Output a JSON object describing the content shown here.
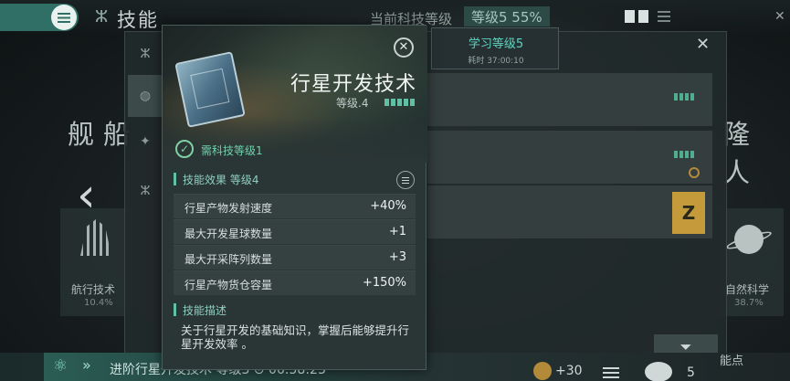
{
  "header": {
    "page_title": "技能",
    "tech_level_label": "当前科技等级",
    "tech_level_value": "等级5 55%"
  },
  "background": {
    "left_heading": "舰船",
    "right_heading": "隆人",
    "left_card": {
      "name": "航行技术",
      "percent": "10.4%"
    },
    "right_card": {
      "name": "自然科学",
      "percent": "38.7%"
    }
  },
  "learn_box": {
    "title": "学习等级5",
    "time": "耗时 37:00:10"
  },
  "popup": {
    "title": "行星开发技术",
    "level_label": "等级.4",
    "level_pips": 4,
    "requirement": "需科技等级1",
    "effects_title": "技能效果 等级4",
    "effects": [
      {
        "label": "行星产物发射速度",
        "value": "+40%"
      },
      {
        "label": "最大开发星球数量",
        "value": "+1"
      },
      {
        "label": "最大开采阵列数量",
        "value": "+3"
      },
      {
        "label": "行星产物货仓容量",
        "value": "+150%"
      }
    ],
    "description_title": "技能描述",
    "description": "关于行星开发的基础知识，掌握后能够提升行星开发效率 。"
  },
  "bottom": {
    "progress_text": "进阶行星开发技术 等级3 ⊙ 06:58:23",
    "coin_value": "+30",
    "count": "5",
    "points_label": "能点"
  },
  "colors": {
    "accent": "#5fc0a4",
    "menu_button": "#2f6f66",
    "gold_badge": "#c49a3a"
  },
  "icons": [
    "menu-icon",
    "dna-icon",
    "grid-view-icon",
    "list-view-icon",
    "close-icon",
    "planet-icon",
    "satellite-icon",
    "check-icon",
    "list-menu-icon",
    "filter-icon",
    "atom-icon",
    "coin-icon"
  ]
}
